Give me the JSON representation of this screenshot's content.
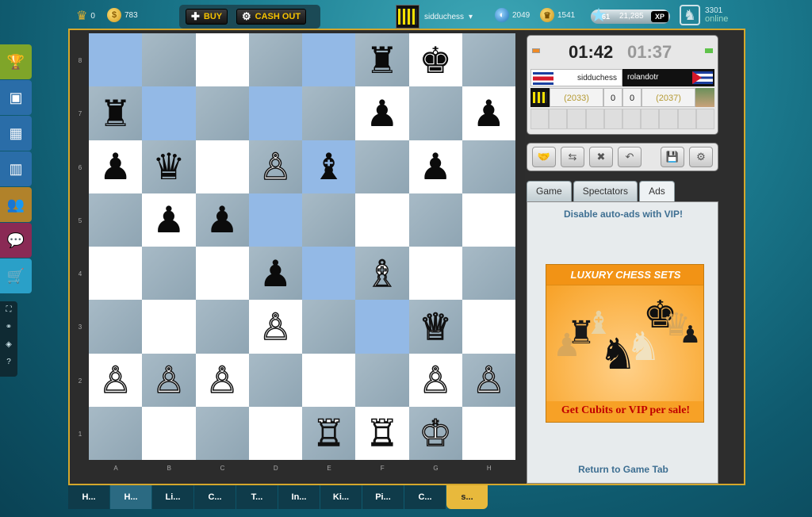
{
  "topbar": {
    "crowns": "0",
    "coins": "783",
    "buy_label": "BUY",
    "cashout_label": "CASH OUT",
    "username": "sidduchess",
    "rating": "2049",
    "trophy": "1541",
    "level": "61",
    "xp": "21,285",
    "xp_tag": "XP",
    "online_count": "3301",
    "online_label": "online"
  },
  "board": {
    "rank_labels": [
      "8",
      "7",
      "6",
      "5",
      "4",
      "3",
      "2",
      "1"
    ],
    "file_labels": [
      "A",
      "B",
      "C",
      "D",
      "E",
      "F",
      "G",
      "H"
    ],
    "rows": [
      [
        {
          "p": "",
          "c": ""
        },
        {
          "p": "",
          "c": ""
        },
        {
          "p": "",
          "c": ""
        },
        {
          "p": "",
          "c": ""
        },
        {
          "p": "",
          "c": ""
        },
        {
          "p": "♜",
          "c": "b"
        },
        {
          "p": "♚",
          "c": "b"
        },
        {
          "p": "",
          "c": ""
        }
      ],
      [
        {
          "p": "♜",
          "c": "b"
        },
        {
          "p": "",
          "c": ""
        },
        {
          "p": "",
          "c": ""
        },
        {
          "p": "",
          "c": ""
        },
        {
          "p": "",
          "c": ""
        },
        {
          "p": "♟",
          "c": "b"
        },
        {
          "p": "",
          "c": ""
        },
        {
          "p": "♟",
          "c": "b"
        }
      ],
      [
        {
          "p": "♟",
          "c": "b"
        },
        {
          "p": "♛",
          "c": "b"
        },
        {
          "p": "",
          "c": ""
        },
        {
          "p": "♙",
          "c": "w"
        },
        {
          "p": "♝",
          "c": "b"
        },
        {
          "p": "",
          "c": ""
        },
        {
          "p": "♟",
          "c": "b"
        },
        {
          "p": "",
          "c": ""
        }
      ],
      [
        {
          "p": "",
          "c": ""
        },
        {
          "p": "♟",
          "c": "b"
        },
        {
          "p": "♟",
          "c": "b"
        },
        {
          "p": "",
          "c": ""
        },
        {
          "p": "",
          "c": ""
        },
        {
          "p": "",
          "c": ""
        },
        {
          "p": "",
          "c": ""
        },
        {
          "p": "",
          "c": ""
        }
      ],
      [
        {
          "p": "",
          "c": ""
        },
        {
          "p": "",
          "c": ""
        },
        {
          "p": "",
          "c": ""
        },
        {
          "p": "♟",
          "c": "b"
        },
        {
          "p": "",
          "c": ""
        },
        {
          "p": "♗",
          "c": "w"
        },
        {
          "p": "",
          "c": ""
        },
        {
          "p": "",
          "c": ""
        }
      ],
      [
        {
          "p": "",
          "c": ""
        },
        {
          "p": "",
          "c": ""
        },
        {
          "p": "",
          "c": ""
        },
        {
          "p": "♙",
          "c": "w"
        },
        {
          "p": "",
          "c": ""
        },
        {
          "p": "",
          "c": ""
        },
        {
          "p": "♕",
          "c": "w"
        },
        {
          "p": "",
          "c": ""
        }
      ],
      [
        {
          "p": "♙",
          "c": "w"
        },
        {
          "p": "♙",
          "c": "w"
        },
        {
          "p": "♙",
          "c": "w"
        },
        {
          "p": "",
          "c": ""
        },
        {
          "p": "",
          "c": ""
        },
        {
          "p": "",
          "c": ""
        },
        {
          "p": "♙",
          "c": "w"
        },
        {
          "p": "♙",
          "c": "w"
        }
      ],
      [
        {
          "p": "",
          "c": ""
        },
        {
          "p": "",
          "c": ""
        },
        {
          "p": "",
          "c": ""
        },
        {
          "p": "",
          "c": ""
        },
        {
          "p": "♖",
          "c": "w"
        },
        {
          "p": "♖",
          "c": "w"
        },
        {
          "p": "♔",
          "c": "w"
        },
        {
          "p": "",
          "c": ""
        }
      ]
    ],
    "highlighted": [
      "a8",
      "b7",
      "d7",
      "d5",
      "e8",
      "e4",
      "f3",
      "d6e5"
    ]
  },
  "clock": {
    "white_time": "01:42",
    "black_time": "01:37",
    "white_name": "sidduchess",
    "black_name": "rolandotr",
    "white_rating": "(2033)",
    "black_rating": "(2037)",
    "white_score": "0",
    "black_score": "0"
  },
  "tabs": [
    "Game",
    "Spectators",
    "Ads"
  ],
  "ads": {
    "vip_text": "Disable auto-ads with VIP!",
    "ad_title": "LUXURY CHESS SETS",
    "ad_footer": "Get Cubits or VIP per sale!",
    "return_text": "Return to Game Tab"
  },
  "taskbar": [
    "H...",
    "H...",
    "Li...",
    "C...",
    "T...",
    "In...",
    "Ki...",
    "Pi...",
    "C...",
    "s..."
  ]
}
